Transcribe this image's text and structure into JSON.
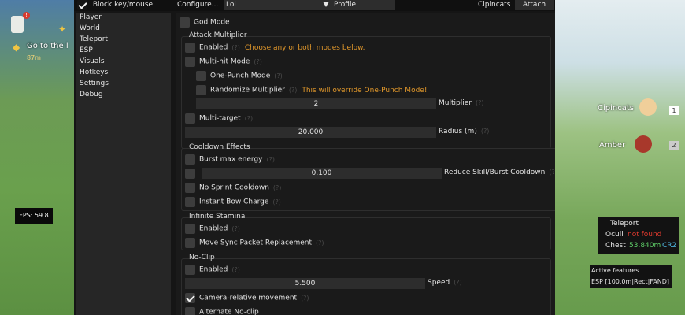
{
  "colors": {
    "accent_warn": "#e0972b",
    "not_found": "#e03a2e",
    "distance": "#60d26a",
    "region": "#4fb8e2"
  },
  "game_hud": {
    "quest_text": "Go to the l",
    "quest_distance": "87m",
    "quest_alert": "!",
    "fps_label": "FPS: 59.8",
    "party": [
      {
        "name": "Cipincats",
        "slot": "1"
      },
      {
        "name": "Amber",
        "slot": "2"
      }
    ]
  },
  "topbar": {
    "block_label": "Block key/mouse",
    "configure_label": "Configure...",
    "profile_value": "Lol",
    "profile_label": "Profile",
    "user_name": "Cipincats",
    "attach_label": "Attach"
  },
  "sidebar": {
    "items": [
      {
        "label": "Player"
      },
      {
        "label": "World"
      },
      {
        "label": "Teleport"
      },
      {
        "label": "ESP"
      },
      {
        "label": "Visuals"
      },
      {
        "label": "Hotkeys"
      },
      {
        "label": "Settings"
      },
      {
        "label": "Debug"
      }
    ]
  },
  "help_marker": "(?)",
  "player": {
    "god_mode": "God Mode",
    "attack": {
      "title": "Attack Multiplier",
      "enabled": "Enabled",
      "enabled_hint": "Choose any or both modes below.",
      "multi_hit": "Multi-hit Mode",
      "one_punch": "One-Punch Mode",
      "randomize": "Randomize Multiplier",
      "randomize_warn": "This will override One-Punch Mode!",
      "multiplier_value": "2",
      "multiplier_label": "Multiplier",
      "multi_target": "Multi-target",
      "radius_value": "20.000",
      "radius_label": "Radius (m)"
    },
    "cooldown": {
      "title": "Cooldown Effects",
      "burst_energy": "Burst max energy",
      "reduce_value": "0.100",
      "reduce_label": "Reduce Skill/Burst Cooldown",
      "no_sprint": "No Sprint Cooldown",
      "instant_bow": "Instant Bow Charge"
    },
    "stamina": {
      "title": "Infinite Stamina",
      "enabled": "Enabled",
      "move_sync": "Move Sync Packet Replacement"
    },
    "noclip": {
      "title": "No-Clip",
      "enabled": "Enabled",
      "speed_value": "5.500",
      "speed_label": "Speed",
      "camera_relative": "Camera-relative movement",
      "alternate": "Alternate No-clip"
    }
  },
  "teleport_overlay": {
    "title": "Teleport",
    "oculi_label": "Oculi",
    "oculi_value": "not found",
    "chest_label": "Chest",
    "chest_distance": "53.840m",
    "chest_region": "CR2"
  },
  "active_features": {
    "title": "Active features",
    "esp": "ESP [100.0m|Rect|FAND]"
  }
}
